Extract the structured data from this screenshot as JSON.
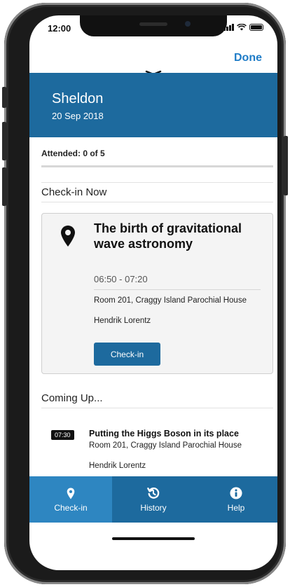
{
  "status_bar": {
    "time": "12:00"
  },
  "nav": {
    "done_label": "Done"
  },
  "header": {
    "name": "Sheldon",
    "date": "20 Sep 2018"
  },
  "attendance": {
    "label": "Attended: 0 of 5",
    "progress_fraction": 0
  },
  "check_in_now": {
    "section_title": "Check-in Now",
    "title": "The birth of gravitational wave astronomy",
    "time": "06:50 - 07:20",
    "room": "Room 201, Craggy Island Parochial House",
    "speaker": "Hendrik Lorentz",
    "button_label": "Check-in",
    "icon": "map-pin-icon"
  },
  "coming_up": {
    "section_title": "Coming Up...",
    "items": [
      {
        "time": "07:30",
        "title": "Putting the Higgs Boson in its place",
        "room": "Room 201, Craggy Island Parochial House",
        "speaker": "Hendrik Lorentz"
      }
    ]
  },
  "tabs": [
    {
      "label": "Check-in",
      "icon": "map-pin-icon",
      "active": true
    },
    {
      "label": "History",
      "icon": "history-icon",
      "active": false
    },
    {
      "label": "Help",
      "icon": "info-icon",
      "active": false
    }
  ],
  "colors": {
    "primary": "#1d6a9e",
    "tab_active": "#2e86c1",
    "link": "#1f7cc7"
  }
}
